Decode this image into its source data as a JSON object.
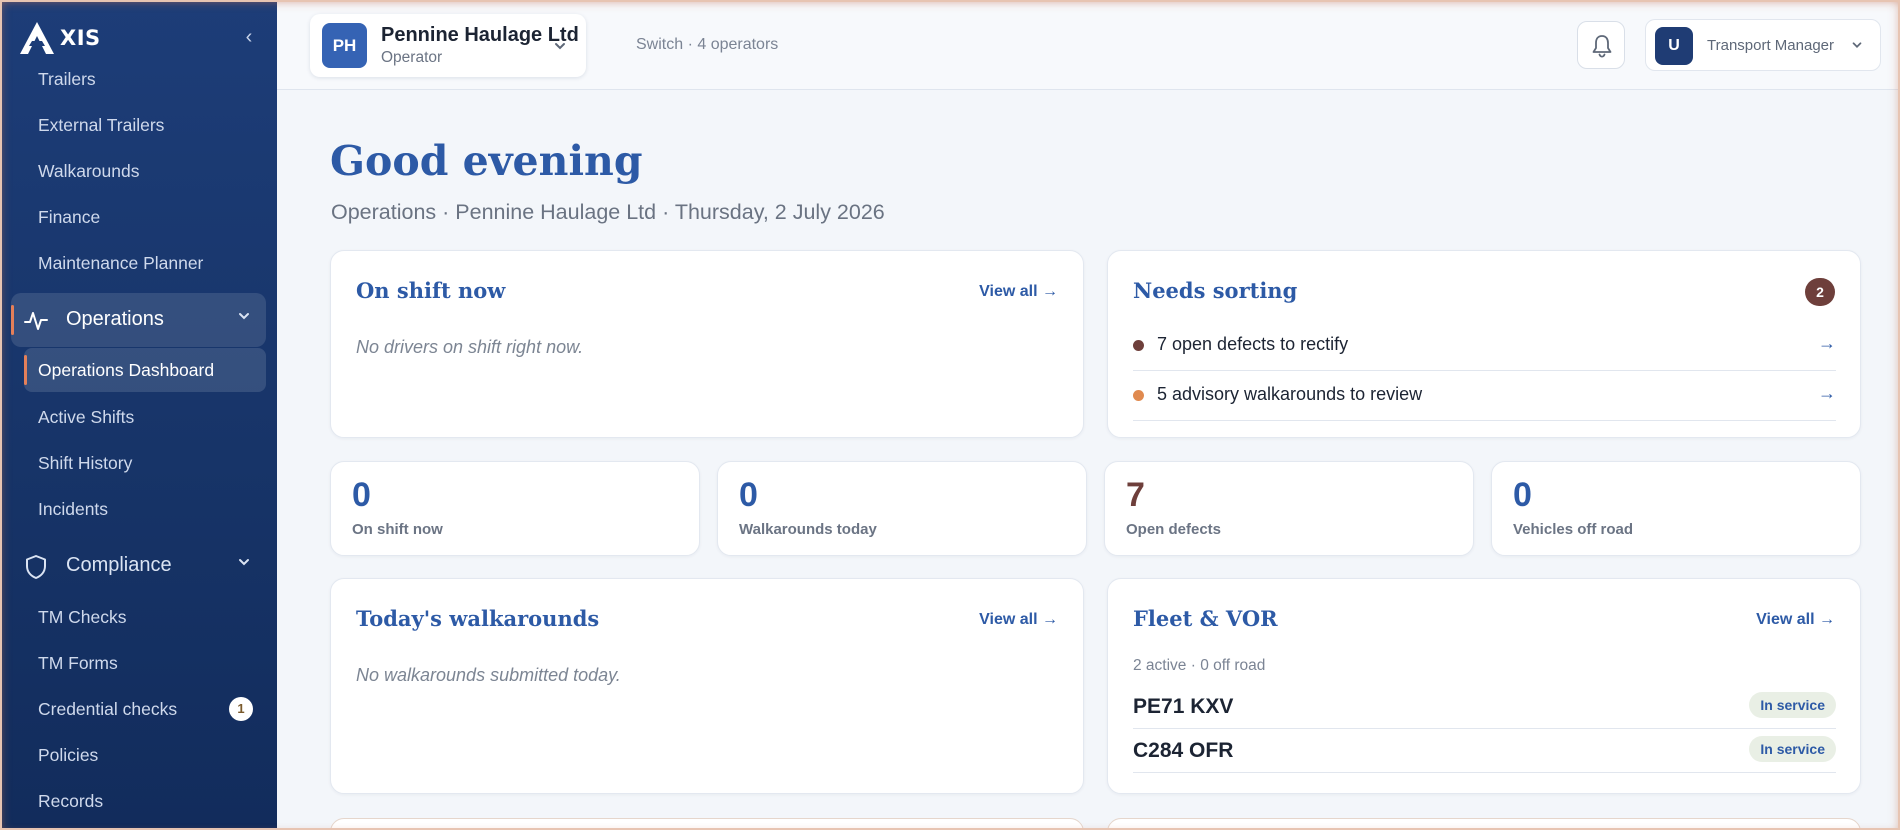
{
  "brand": {
    "text": "XIS"
  },
  "sidebar": {
    "items_top": [
      "Trailers",
      "External Trailers",
      "Walkarounds",
      "Finance",
      "Maintenance Planner"
    ],
    "operations": {
      "label": "Operations",
      "children": [
        "Operations Dashboard",
        "Active Shifts",
        "Shift History",
        "Incidents"
      ]
    },
    "compliance": {
      "label": "Compliance",
      "children": [
        "TM Checks",
        "TM Forms",
        "Credential checks",
        "Policies",
        "Records"
      ],
      "credential_badge": "1"
    }
  },
  "topbar": {
    "operator_initials": "PH",
    "operator_name": "Pennine Haulage Ltd",
    "operator_role": "Operator",
    "switch_text": "Switch · 4 operators",
    "user_initial": "U",
    "user_role": "Transport Manager"
  },
  "main": {
    "greeting": "Good evening",
    "subline": "Operations · Pennine Haulage Ltd · Thursday, 2 July 2026",
    "view_all": "View all →",
    "on_shift": {
      "title": "On shift now",
      "empty": "No drivers on shift right now."
    },
    "needs_sorting": {
      "title": "Needs sorting",
      "count": "2",
      "items": [
        {
          "text": "7 open defects to rectify",
          "color": "#6e3f3b"
        },
        {
          "text": "5 advisory walkarounds to review",
          "color": "#e08a4f"
        }
      ],
      "arrow": "→"
    },
    "stats": [
      {
        "value": "0",
        "label": "On shift now",
        "color": "#2d5aa6"
      },
      {
        "value": "0",
        "label": "Walkarounds today",
        "color": "#2d5aa6"
      },
      {
        "value": "7",
        "label": "Open defects",
        "color": "#6e3f3b"
      },
      {
        "value": "0",
        "label": "Vehicles off road",
        "color": "#2d5aa6"
      }
    ],
    "walkarounds": {
      "title": "Today's walkarounds",
      "empty": "No walkarounds submitted today."
    },
    "fleet": {
      "title": "Fleet & VOR",
      "summary": "2 active · 0 off road",
      "vehicles": [
        {
          "reg": "PE71 KXV",
          "status": "In service"
        },
        {
          "reg": "C284 OFR",
          "status": "In service"
        }
      ]
    }
  },
  "colors": {
    "accent": "#2d5aa6",
    "sidebar": "#1d3d78",
    "highlight": "#e4805a"
  }
}
